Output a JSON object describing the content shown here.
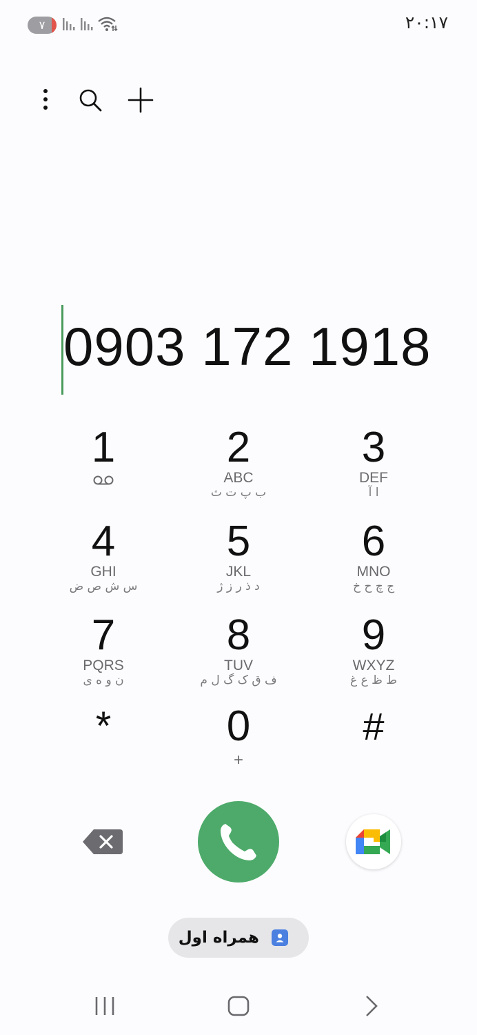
{
  "status_bar": {
    "time": "۲۰:۱۷",
    "battery_level": "۷",
    "icons": [
      "signal-sim1-icon",
      "signal-sim2-icon",
      "wifi-icon"
    ]
  },
  "toolbar": {
    "icons": [
      "more-options-icon",
      "search-icon",
      "add-contact-icon"
    ]
  },
  "dialed_number": "0903 172 1918",
  "keypad": {
    "keys": [
      {
        "digit": "1",
        "letters": "",
        "persian": "",
        "icon": "voicemail-icon"
      },
      {
        "digit": "2",
        "letters": "ABC",
        "persian": "ب پ ت ث"
      },
      {
        "digit": "3",
        "letters": "DEF",
        "persian": "ا آ"
      },
      {
        "digit": "4",
        "letters": "GHI",
        "persian": "س ش ص ض"
      },
      {
        "digit": "5",
        "letters": "JKL",
        "persian": "د ذ ر ز ژ"
      },
      {
        "digit": "6",
        "letters": "MNO",
        "persian": "ج چ ح خ"
      },
      {
        "digit": "7",
        "letters": "PQRS",
        "persian": "ن و ه ی"
      },
      {
        "digit": "8",
        "letters": "TUV",
        "persian": "ف ق ک گ ل م"
      },
      {
        "digit": "9",
        "letters": "WXYZ",
        "persian": "ط ظ ع غ"
      },
      {
        "digit": "*",
        "letters": "",
        "persian": ""
      },
      {
        "digit": "0",
        "letters": "+",
        "persian": ""
      },
      {
        "digit": "#",
        "letters": "",
        "persian": ""
      }
    ]
  },
  "actions": {
    "icons": [
      "backspace-icon",
      "phone-call-icon",
      "google-meet-icon"
    ],
    "colors": {
      "call": "#4daa6a",
      "backspace": "#6b6b70"
    }
  },
  "sim_selector": {
    "label": "همراه اول",
    "icon": "contact-card-icon",
    "icon_color": "#4b7fe0"
  },
  "nav_bar": {
    "icons": [
      "recent-apps-icon",
      "home-icon",
      "back-icon"
    ]
  }
}
